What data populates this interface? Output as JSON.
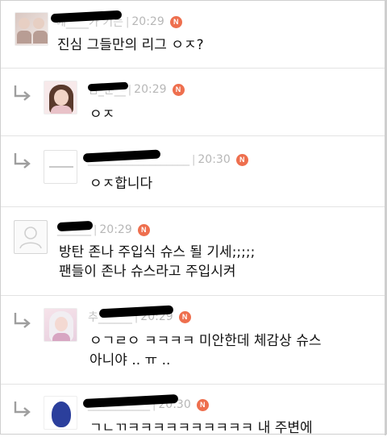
{
  "comments": [
    {
      "author": "에____가 기는",
      "time": "20:29",
      "badge": "N",
      "text": "진심 그들만의 리그 ㅇㅈ?"
    },
    {
      "author": "김_준__",
      "time": "20:29",
      "badge": "N",
      "text": "ㅇㅈ"
    },
    {
      "author": "__________________",
      "time": "20:30",
      "badge": "N",
      "text": "ㅇㅈ합니다"
    },
    {
      "author": "______",
      "time": "20:29",
      "badge": "N",
      "text": "방탄 존나 주입식 슈스 될 기세;;;;;\n팬들이 존나 슈스라고 주입시켜"
    },
    {
      "author": "추______",
      "time": "20:29",
      "badge": "N",
      "text": "ㅇㄱㄹㅇ ㅋㅋㅋㅋ 미안한데 체감상 슈스\n아니야 .. ㅠ .."
    },
    {
      "author": "___________",
      "time": "20:30",
      "badge": "N",
      "text": "ㄱㄴㄲㅋㅋㅋㅋㅋㅋㅋㅋㅋㅋ 내 주변에"
    }
  ],
  "icons": {
    "reply": "reply-arrow-icon",
    "default_avatar": "default-user-icon",
    "badge_color": "#ee6f4e"
  }
}
